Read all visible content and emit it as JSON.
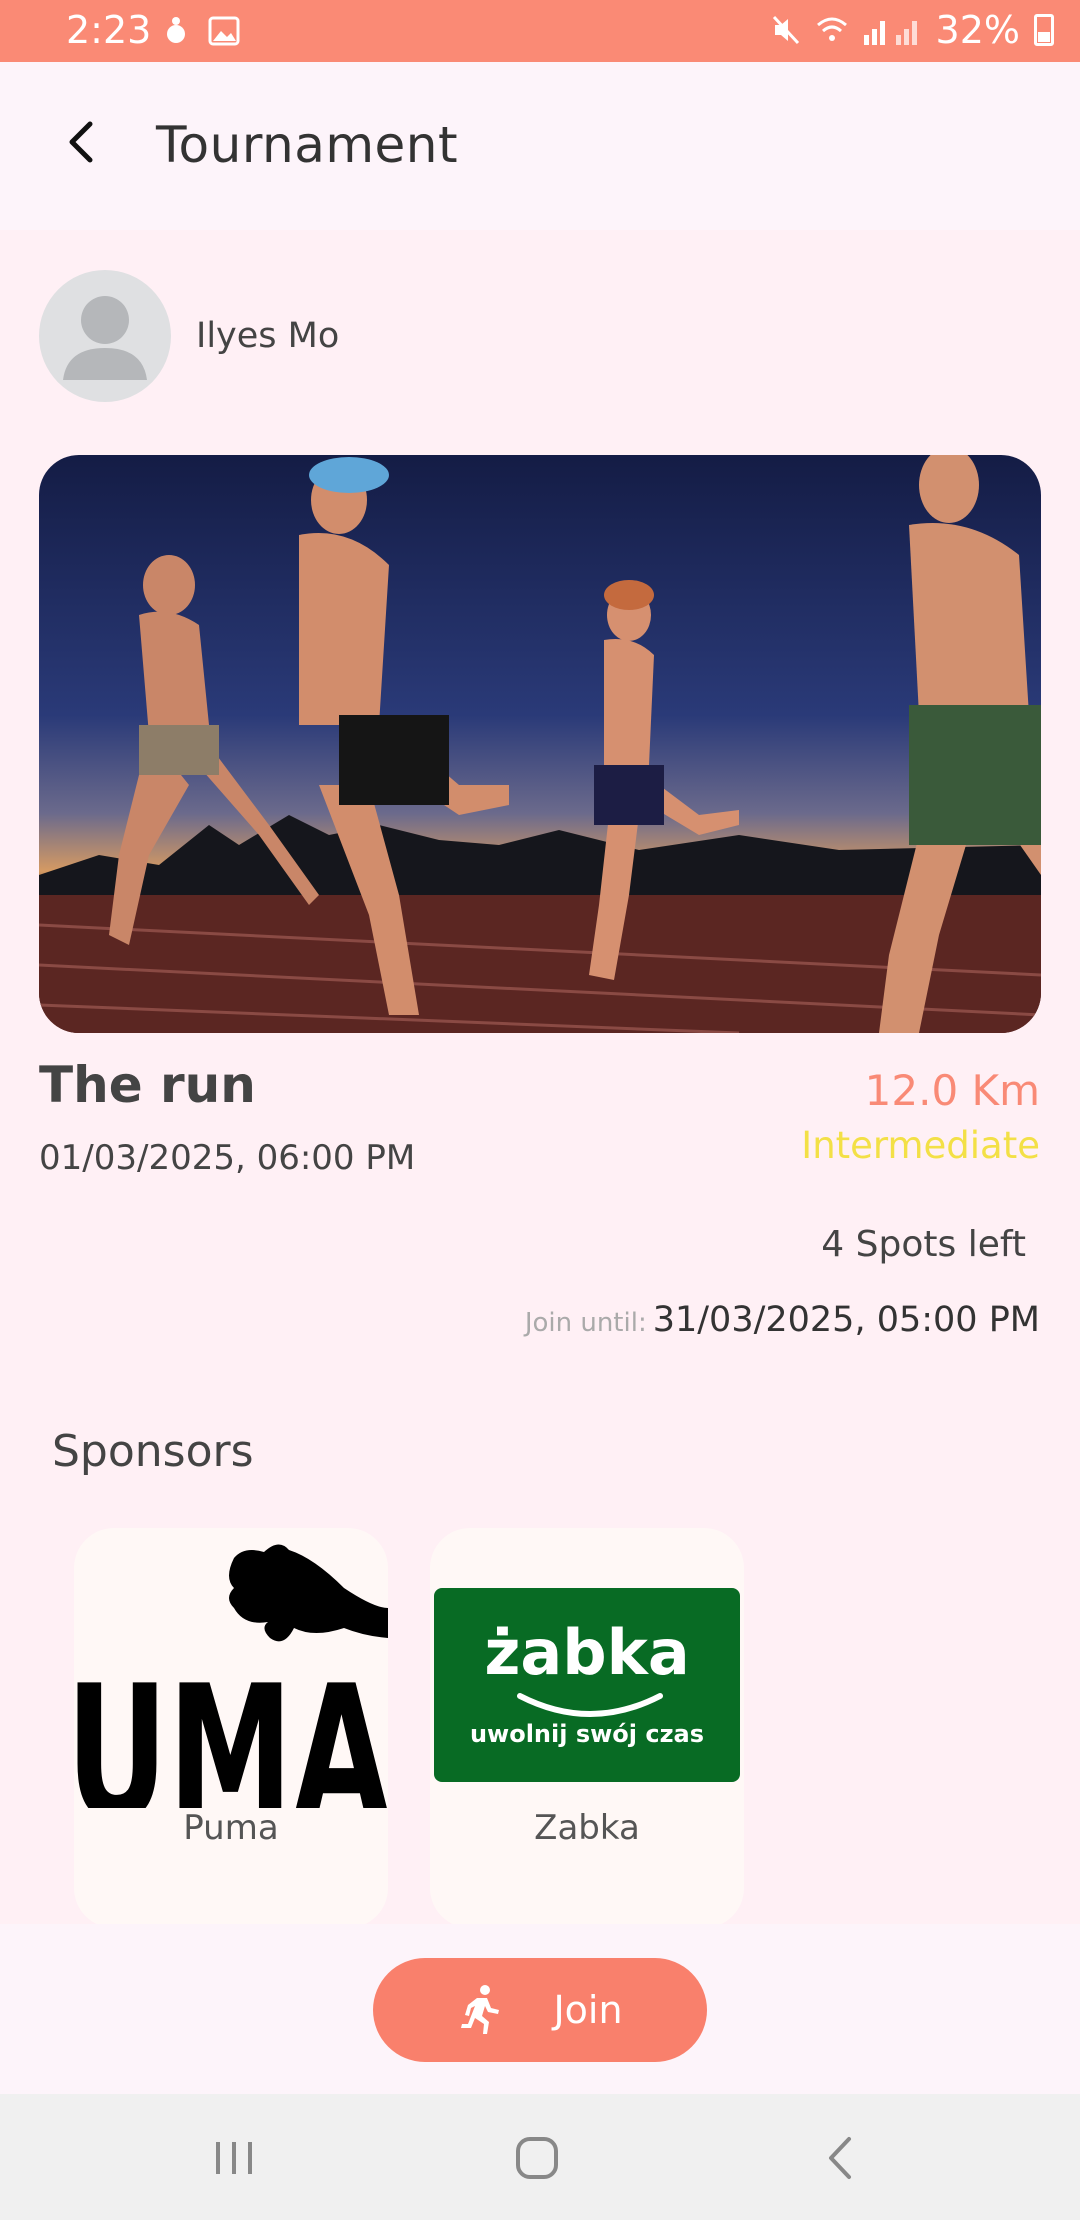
{
  "status_bar": {
    "time": "2:23",
    "battery": "32%",
    "icons": [
      "notification-icon",
      "image-icon",
      "mute-icon",
      "wifi-icon",
      "signal-icon",
      "battery-icon"
    ]
  },
  "app_bar": {
    "title": "Tournament",
    "back_icon": "chevron-left-icon"
  },
  "organizer": {
    "name": "Ilyes Mo"
  },
  "event": {
    "title": "The run",
    "date": "01/03/2025, 06:00 PM",
    "distance": "12.0 Km",
    "level": "Intermediate",
    "spots": "4 Spots left",
    "join_until_label": "Join until:",
    "join_until": "31/03/2025, 05:00 PM"
  },
  "sponsors": {
    "title": "Sponsors",
    "items": [
      {
        "name": "Puma",
        "logo_text": "UMA"
      },
      {
        "name": "Zabka",
        "logo_text": "żabka",
        "logo_tagline": "uwolnij swój czas"
      }
    ]
  },
  "join_button": {
    "label": "Join",
    "icon": "runner-icon"
  },
  "colors": {
    "accent": "#fa8a75",
    "distance": "#f98a76",
    "level": "#f3e046",
    "zabka_green": "#086b24"
  }
}
